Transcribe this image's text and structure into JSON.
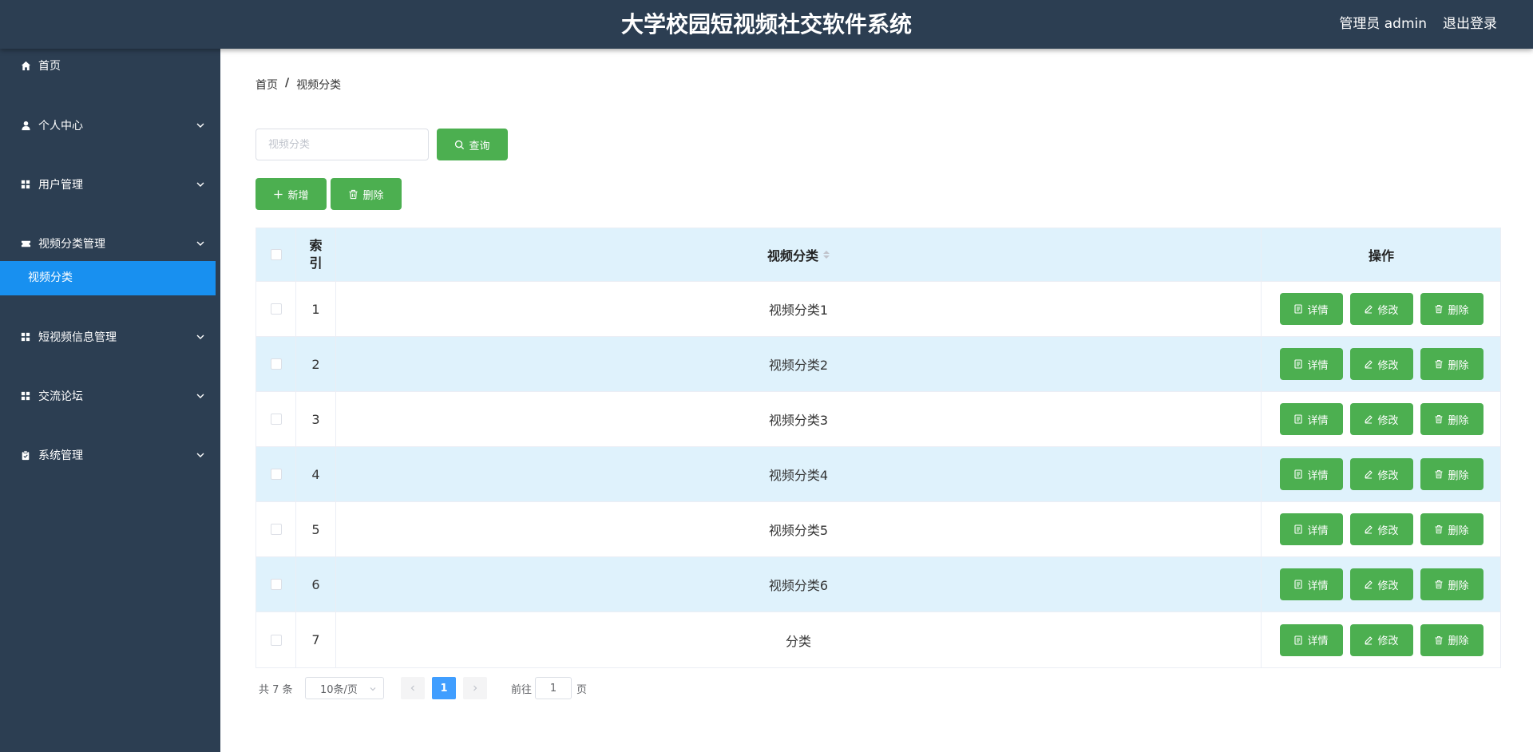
{
  "header": {
    "title": "大学校园短视频社交软件系统",
    "user": "管理员 admin",
    "logout": "退出登录"
  },
  "sidebar": {
    "items": [
      {
        "label": "首页",
        "icon": "home-icon"
      },
      {
        "label": "个人中心",
        "icon": "user-icon"
      },
      {
        "label": "用户管理",
        "icon": "grid-icon"
      },
      {
        "label": "视频分类管理",
        "icon": "ticket-icon"
      },
      {
        "label": "短视频信息管理",
        "icon": "grid-icon"
      },
      {
        "label": "交流论坛",
        "icon": "grid-icon"
      },
      {
        "label": "系统管理",
        "icon": "clipboard-icon"
      }
    ],
    "active_sub": "视频分类"
  },
  "breadcrumb": {
    "home": "首页",
    "sep": "/",
    "current": "视频分类"
  },
  "search": {
    "placeholder": "视频分类",
    "button": "查询"
  },
  "actions": {
    "add": "新增",
    "delete": "删除"
  },
  "table": {
    "headers": {
      "index": "索\n引",
      "name": "视频分类",
      "ops": "操作"
    },
    "rows": [
      {
        "index": "1",
        "name": "视频分类1"
      },
      {
        "index": "2",
        "name": "视频分类2"
      },
      {
        "index": "3",
        "name": "视频分类3"
      },
      {
        "index": "4",
        "name": "视频分类4"
      },
      {
        "index": "5",
        "name": "视频分类5"
      },
      {
        "index": "6",
        "name": "视频分类6"
      },
      {
        "index": "7",
        "name": "分类"
      }
    ],
    "op_labels": {
      "detail": "详情",
      "edit": "修改",
      "delete": "删除"
    }
  },
  "pagination": {
    "total": "共 7 条",
    "page_size": "10条/页",
    "current_page": "1",
    "goto": "前往",
    "jump_value": "1",
    "page_word": "页"
  },
  "colors": {
    "header": "#2c3e52",
    "active": "#1890f0",
    "green": "#4caf50",
    "row_alt": "#dff2fc",
    "page": "#409eff"
  }
}
